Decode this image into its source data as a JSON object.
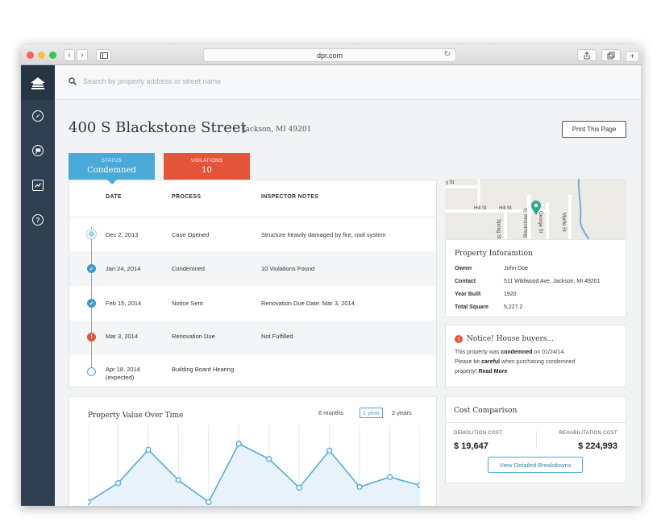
{
  "browser": {
    "url": "dpr.com"
  },
  "search": {
    "placeholder": "Search by property address or street name"
  },
  "header": {
    "title": "400 S Blackstone Street",
    "subtitle": "Jackson, MI 49201",
    "print_label": "Print This Page"
  },
  "tabs": {
    "status": {
      "label": "STATUS",
      "value": "Condemned"
    },
    "violations": {
      "label": "VIOLATIONS",
      "value": "10"
    }
  },
  "timeline": {
    "headers": {
      "date": "DATE",
      "process": "PROCESS",
      "notes": "INSPECTOR NOTES"
    },
    "rows": [
      {
        "date": "Dec 2, 2013",
        "process": "Case Opened",
        "notes": "Structure heavily damaged by fire, roof system",
        "state": "done"
      },
      {
        "date": "Jan 24, 2014",
        "process": "Condemned",
        "notes": "10 Violations Found",
        "state": "done"
      },
      {
        "date": "Feb 15, 2014",
        "process": "Notice Sent",
        "notes": "Renovation Due Date: Mar 3, 2014",
        "state": "done"
      },
      {
        "date": "Mar 3, 2014",
        "process": "Renovation Due",
        "notes": "Not Fulfilled",
        "state": "alert"
      },
      {
        "date": "Apr 18, 2014",
        "date2": "(expected)",
        "process": "Building Board Hearing",
        "notes": "",
        "state": "pending"
      }
    ]
  },
  "map": {
    "labels": [
      "y St",
      "Hill St",
      "Hill St",
      "Spring St",
      "Blackstone St",
      "George St",
      "Myrtle St"
    ]
  },
  "property_info": {
    "title": "Property Inforamtion",
    "rows": [
      {
        "key": "Owner",
        "value": "John Doe"
      },
      {
        "key": "Contact",
        "value": "511 Wildwood Ave, Jackson, MI 49201"
      },
      {
        "key": "Year Built",
        "value": "1920"
      },
      {
        "key": "Total Square",
        "value": "5,227.2"
      }
    ]
  },
  "notice": {
    "title": "Notice! House buyers...",
    "line1_a": "This property was ",
    "line1_b": "condemned",
    "line1_c": " on 01/24/14.",
    "line2_a": "Please be ",
    "line2_b": "careful",
    "line2_c": " when purchasing condemned",
    "line3_a": "property! ",
    "line3_b": "Read More"
  },
  "cost": {
    "title": "Cost Comparison",
    "demolition_label": "DEMOLITION COST",
    "demolition_value": "$ 19,647",
    "rehab_label": "REHABILITATION COST",
    "rehab_value": "$ 224,993",
    "button": "View Detailed Breakdowns"
  },
  "chart_data": {
    "type": "area",
    "title": "Property Value Over Time",
    "ranges": [
      "6 months",
      "1 year",
      "2 years"
    ],
    "selected_range": "1 year",
    "values": [
      0.05,
      0.3,
      0.74,
      0.34,
      0.05,
      0.82,
      0.62,
      0.24,
      0.73,
      0.25,
      0.38,
      0.27
    ],
    "accent": "#4aa9d6"
  }
}
